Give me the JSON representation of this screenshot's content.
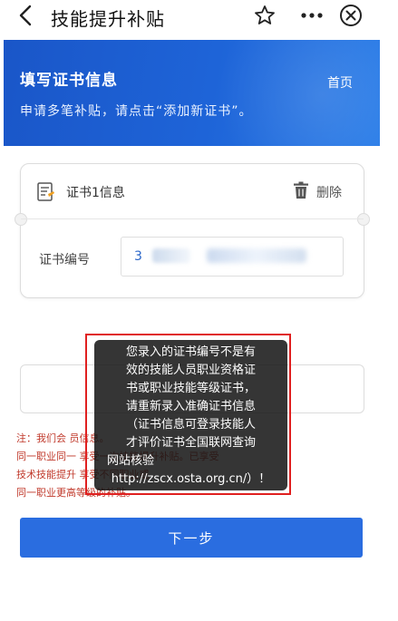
{
  "nav": {
    "title": "技能提升补贴",
    "back_icon": "chevron-left-icon",
    "star_icon": "star-outline-icon",
    "more_icon": "more-dots-icon",
    "close_icon": "close-circle-icon"
  },
  "banner": {
    "title": "填写证书信息",
    "home_link": "首页",
    "subtitle": "申请多笔补贴，请点击“添加新证书”。"
  },
  "certificate": {
    "title": "证书1信息",
    "delete_label": "删除",
    "number_label": "证书编号",
    "number_value": "3"
  },
  "note": {
    "lines": [
      "注：我们会                                          员信息。",
      "同一职业同一                          享受一次技能提升补贴。已享受",
      "技术技能提升                                          享受不同职业或",
      "同一职业更高等级的补贴。"
    ]
  },
  "toast": {
    "lines": [
      "您录入的证书编号不是有",
      "效的技能人员职业资格证",
      "书或职业技能等级证书，",
      "请重新录入准确证书信息",
      "（证书信息可登录技能人",
      "才评价证书全国联网查询",
      "网站核验",
      "http://zscx.osta.org.cn/）！"
    ]
  },
  "next_button": {
    "label": "下一步"
  },
  "colors": {
    "primary": "#2a6de0",
    "banner": "#1e5fd2",
    "note_red": "#c0392b",
    "toast_bg": "#141414",
    "highlight_red": "#e02020"
  }
}
